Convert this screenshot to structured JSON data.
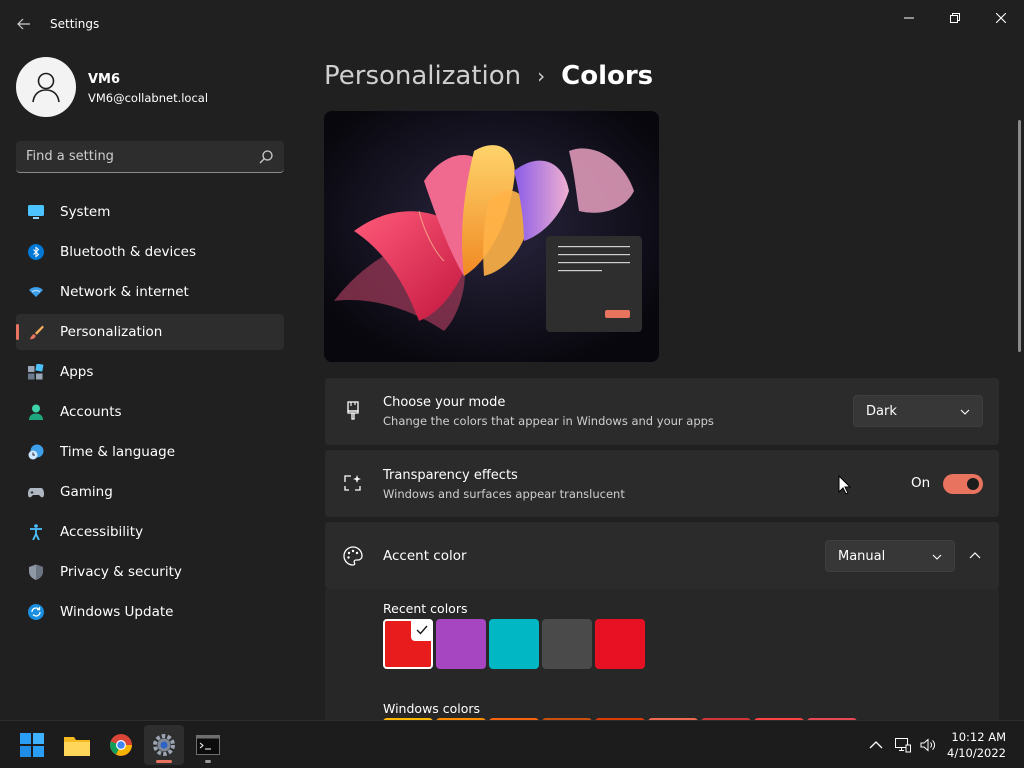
{
  "window": {
    "title": "Settings"
  },
  "profile": {
    "name": "VM6",
    "email": "VM6@collabnet.local"
  },
  "search": {
    "placeholder": "Find a setting"
  },
  "sidebar": {
    "items": [
      {
        "label": "System",
        "icon": "monitor-icon"
      },
      {
        "label": "Bluetooth & devices",
        "icon": "bluetooth-icon"
      },
      {
        "label": "Network & internet",
        "icon": "wifi-icon"
      },
      {
        "label": "Personalization",
        "icon": "brush-icon",
        "active": true
      },
      {
        "label": "Apps",
        "icon": "apps-icon"
      },
      {
        "label": "Accounts",
        "icon": "person-icon"
      },
      {
        "label": "Time & language",
        "icon": "clock-globe-icon"
      },
      {
        "label": "Gaming",
        "icon": "gamepad-icon"
      },
      {
        "label": "Accessibility",
        "icon": "accessibility-icon"
      },
      {
        "label": "Privacy & security",
        "icon": "shield-icon"
      },
      {
        "label": "Windows Update",
        "icon": "update-icon"
      }
    ]
  },
  "breadcrumb": {
    "parent": "Personalization",
    "separator": "›",
    "current": "Colors"
  },
  "mode_card": {
    "title": "Choose your mode",
    "desc": "Change the colors that appear in Windows and your apps",
    "value": "Dark"
  },
  "transparency_card": {
    "title": "Transparency effects",
    "desc": "Windows and surfaces appear translucent",
    "state": "On"
  },
  "accent_card": {
    "title": "Accent color",
    "value": "Manual"
  },
  "recent_colors": {
    "label": "Recent colors",
    "swatches": [
      "#e81c1c",
      "#a646c0",
      "#00b7c3",
      "#4a4a4a",
      "#e81123"
    ],
    "selected_index": 0
  },
  "windows_colors": {
    "label": "Windows colors",
    "swatches": [
      "#ffb900",
      "#ff8c00",
      "#f7630c",
      "#ca5010",
      "#da3b01",
      "#ef6950",
      "#d13438",
      "#ff4343",
      "#e74856"
    ]
  },
  "taskbar": {
    "apps": [
      "windows-start-icon",
      "file-explorer-icon",
      "chrome-icon",
      "settings-gear-icon",
      "terminal-icon"
    ],
    "time": "10:12 AM",
    "date": "4/10/2022"
  },
  "colors": {
    "accent": "#e8735e",
    "background": "#202020",
    "card": "#2b2b2b"
  }
}
